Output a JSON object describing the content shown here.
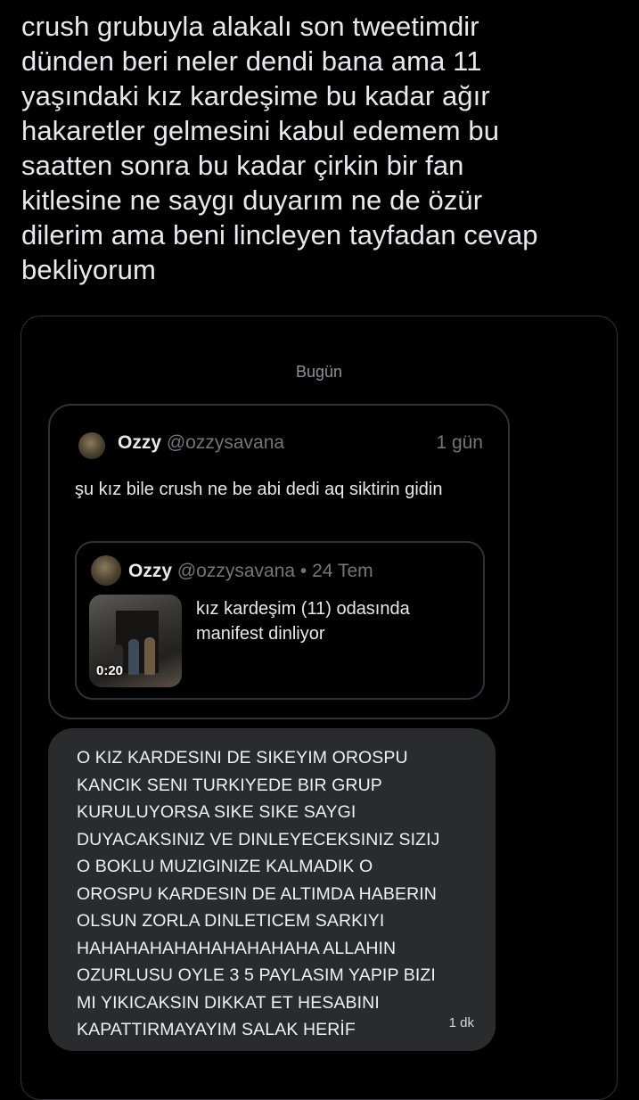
{
  "tweet": {
    "text": "crush grubuyla alakalı son tweetimdir\ndünden beri neler dendi bana ama 11\nyaşındaki kız kardeşime bu kadar ağır\nhakaretler gelmesini kabul edemem bu\nsaatten sonra bu kadar çirkin bir fan\nkitlesine ne saygı duyarım ne de özür\ndilerim ama beni lincleyen tayfadan cevap\nbekliyorum"
  },
  "dm": {
    "day_label": "Bugün",
    "shared_tweet": {
      "display_name": "Ozzy",
      "handle": "@ozzysavana",
      "time": "1 gün",
      "text": "şu kız bile crush ne be abi dedi aq siktirin gidin",
      "quoted": {
        "display_name": "Ozzy",
        "handle": "@ozzysavana",
        "separator": "•",
        "date": "24 Tem",
        "video_duration": "0:20",
        "text": "kız kardeşim (11) odasında manifest dinliyor"
      }
    },
    "message": {
      "text": "O KIZ KARDESINI DE SIKEYIM OROSPU\nKANCIK SENI TURKIYEDE BIR GRUP\nKURULUYORSA SIKE SIKE SAYGI\nDUYACAKSINIZ VE DINLEYECEKSINIZ SIZIJ\nO BOKLU MUZIGINIZE KALMADIK O\nOROSPU KARDESIN DE ALTIMDA HABERIN\nOLSUN ZORLA DINLETICEM SARKIYI\nHAHAHAHAHAHAHAHAHAHA ALLAHIN\nOZURLUSU OYLE 3 5 PAYLASIM YAPIP BIZI\nMI YIKICAKSIN DIKKAT ET HESABINI\nKAPATTIRMAYAYIM SALAK HERİF",
      "time": "1 dk"
    }
  },
  "colors": {
    "background": "#000000",
    "text": "#e7e9ea",
    "muted": "#71767b",
    "border": "#2f3336",
    "bubble": "#2a2b2d"
  }
}
